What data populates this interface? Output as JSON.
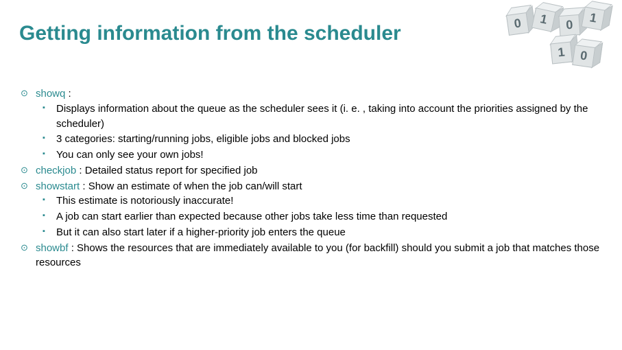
{
  "title": "Getting information from the scheduler",
  "cubes": [
    "0",
    "1",
    "0",
    "1",
    "1",
    "0"
  ],
  "items": [
    {
      "cmd": "showq",
      "after": " :",
      "subs": [
        "Displays information about the queue as the scheduler sees it (i. e. , taking into account the priorities assigned by the scheduler)",
        "3 categories: starting/running jobs, eligible jobs and blocked jobs",
        "You can only see your own jobs!"
      ]
    },
    {
      "cmd": "checkjob",
      "after": " : Detailed status report for specified job",
      "subs": []
    },
    {
      "cmd": "showstart",
      "after": " : Show an estimate of when the job can/will start",
      "subs": [
        "This estimate is notoriously inaccurate!",
        "A job can start earlier than expected because other jobs take less time than requested",
        "But it can also start later if a higher-priority job enters the queue"
      ]
    },
    {
      "cmd": "showbf",
      "after": " : Shows the resources that are immediately available to you (for backfill) should you submit a job that matches those resources",
      "subs": []
    }
  ]
}
